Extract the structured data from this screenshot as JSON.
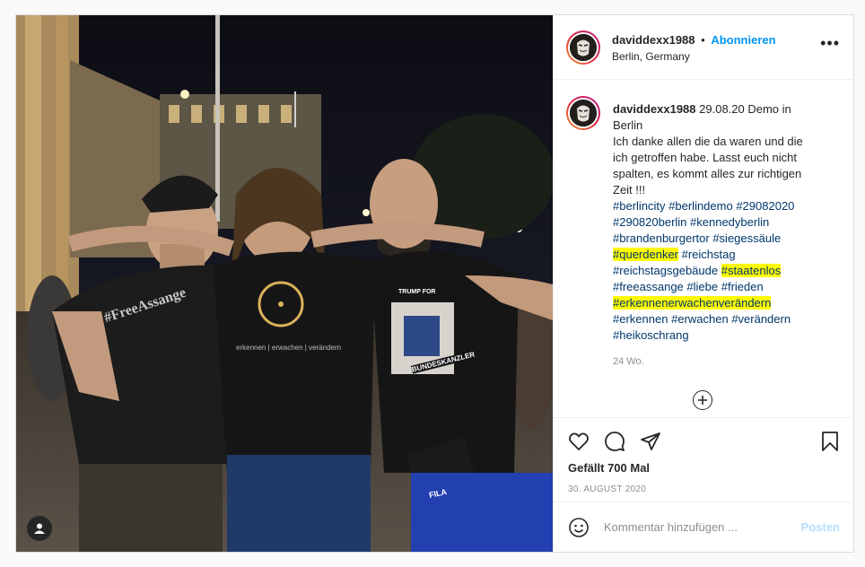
{
  "post": {
    "username": "daviddexx1988",
    "separator": "•",
    "follow_label": "Abonnieren",
    "location": "Berlin, Germany",
    "caption": {
      "username": "daviddexx1988",
      "lines": [
        "29.08.20 Demo in",
        "Berlin",
        "Ich danke allen die da waren und die",
        "ich getroffen habe. Lasst euch nicht",
        "spalten, es kommt alles zur richtigen",
        "Zeit !!!"
      ],
      "hashtags": {
        "l1a": "#berlincity",
        "l1b": "#berlindemo",
        "l1c": "#29082020",
        "l2a": "#290820berlin",
        "l2b": "#kennedyberlin",
        "l3a": "#brandenburgertor",
        "l3b": "#siegessäule",
        "l4a": "#querdenker",
        "l4b": "#reichstag",
        "l5a": "#reichstagsgebäude",
        "l5b": "#staatenlos",
        "l6a": "#freeassange",
        "l6b": "#liebe",
        "l6c": "#frieden",
        "l7a": "#erkennenerwachenverändern",
        "l8a": "#erkennen",
        "l8b": "#erwachen",
        "l8c": "#verändern",
        "l9a": "#heikoschrang"
      }
    },
    "time_ago": "24 Wo.",
    "likes": "Gefällt 700 Mal",
    "date": "30. AUGUST 2020",
    "comment_placeholder": "Kommentar hinzufügen ...",
    "post_button": "Posten",
    "photo_texts": {
      "shirt_left": "#FreeAssange",
      "shirt_middle": "erkennen | erwachen | verändern",
      "shirt_right_top": "TRUMP FOR",
      "shirt_right_bottom": "BUNDESKANZLER",
      "shorts": "FILA"
    }
  },
  "icons": [
    "more-icon",
    "heart-icon",
    "comment-icon",
    "share-icon",
    "bookmark-icon",
    "plus-circle-icon",
    "emoji-icon",
    "user-tag-icon"
  ],
  "colors": {
    "link": "#00376b",
    "follow": "#0095f6",
    "highlight": "#fffb00",
    "post_disabled": "#b2dffc"
  }
}
